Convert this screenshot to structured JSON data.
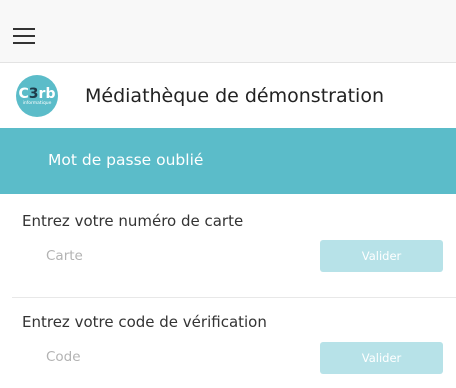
{
  "header": {
    "logo_text_prefix": "C",
    "logo_text_digit": "3",
    "logo_text_suffix": "rb",
    "logo_subtext": "informatique",
    "library_name": "Médiathèque de démonstration"
  },
  "banner": {
    "title": "Mot de passe oublié"
  },
  "card_section": {
    "label": "Entrez votre numéro de carte",
    "input_placeholder": "Carte",
    "input_value": "",
    "button_label": "Valider"
  },
  "code_section": {
    "label": "Entrez votre code de vérification",
    "input_placeholder": "Code",
    "input_value": "",
    "button_label": "Valider"
  },
  "icons": {
    "menu": "hamburger-menu-icon",
    "logo": "c3rb-logo"
  },
  "colors": {
    "accent": "#5bbcc9",
    "button_disabled": "#b7e2e8",
    "topbar_bg": "#f8f8f8"
  }
}
